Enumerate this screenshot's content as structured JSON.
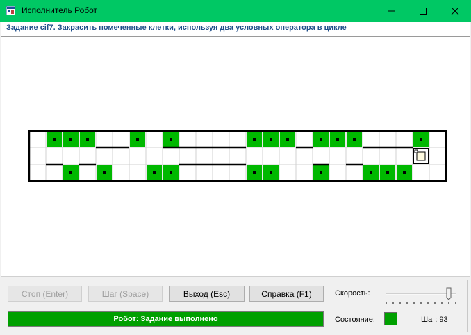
{
  "window": {
    "title": "Исполнитель Робот",
    "minimize_icon": "minimize-icon",
    "maximize_icon": "maximize-icon",
    "close_icon": "close-icon"
  },
  "task": {
    "text": "Задание cif7. Закрасить помеченные клетки, используя два условных оператора в цикле"
  },
  "field": {
    "columns": 25,
    "rows": 3,
    "painted_color": "#00b800",
    "grid_color": "#d0d0d0",
    "marked_cells": [
      [
        0,
        1
      ],
      [
        0,
        2
      ],
      [
        0,
        3
      ],
      [
        0,
        6
      ],
      [
        0,
        8
      ],
      [
        0,
        13
      ],
      [
        0,
        14
      ],
      [
        0,
        15
      ],
      [
        0,
        17
      ],
      [
        0,
        18
      ],
      [
        0,
        19
      ],
      [
        0,
        23
      ],
      [
        2,
        2
      ],
      [
        2,
        4
      ],
      [
        2,
        7
      ],
      [
        2,
        8
      ],
      [
        2,
        13
      ],
      [
        2,
        14
      ],
      [
        2,
        17
      ],
      [
        2,
        20
      ],
      [
        2,
        21
      ],
      [
        2,
        22
      ]
    ],
    "walls_between_row0_row1": [
      4,
      5,
      8,
      9,
      10,
      11,
      12,
      16,
      20,
      21,
      22
    ],
    "walls_between_row1_row2": [
      1,
      3,
      9,
      10,
      11,
      12,
      17,
      19
    ],
    "robot": {
      "row": 1,
      "col": 23
    }
  },
  "buttons": {
    "stop": "Стоп (Enter)",
    "step": "Шаг (Space)",
    "exit": "Выход (Esc)",
    "help": "Справка (F1)"
  },
  "status": {
    "message": "Робот: Задание выполнено",
    "color": "#00a000"
  },
  "controls": {
    "speed_label": "Скорость:",
    "speed_value": 0.9,
    "state_label": "Состояние:",
    "state_color": "#00a000",
    "step_text": "Шаг: 93"
  }
}
